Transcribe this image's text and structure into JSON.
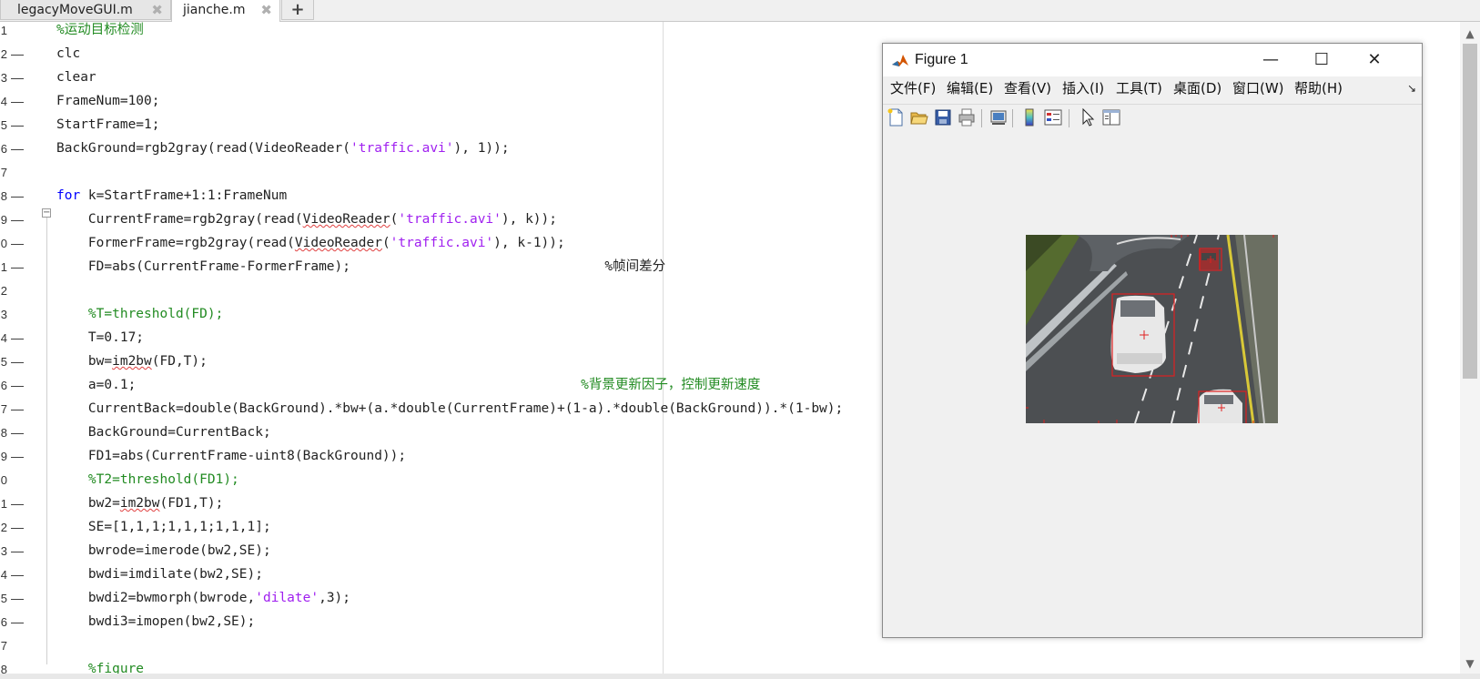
{
  "tabs": [
    {
      "label": "legacyMoveGUI.m",
      "active": false
    },
    {
      "label": "jianche.m",
      "active": true
    }
  ],
  "tab_add_label": "+",
  "tab_close_glyph": "✖",
  "editor": {
    "line_numbers": [
      "1",
      "2",
      "3",
      "4",
      "5",
      "6",
      "7",
      "8",
      "9",
      "0",
      "1",
      "2",
      "3",
      "4",
      "5",
      "6",
      "7",
      "8",
      "9",
      "0",
      "1",
      "2",
      "3",
      "4",
      "5",
      "6",
      "7",
      "8"
    ],
    "lines": [
      [
        {
          "t": "%运动目标检测",
          "c": "cm"
        }
      ],
      [
        {
          "t": "clc",
          "c": ""
        }
      ],
      [
        {
          "t": "clear",
          "c": ""
        }
      ],
      [
        {
          "t": "FrameNum=100;",
          "c": ""
        }
      ],
      [
        {
          "t": "StartFrame=1;",
          "c": ""
        }
      ],
      [
        {
          "t": "BackGround=rgb2gray(read(VideoReader(",
          "c": ""
        },
        {
          "t": "'traffic.avi'",
          "c": "str"
        },
        {
          "t": "), 1));",
          "c": ""
        }
      ],
      [],
      [
        {
          "t": "for",
          "c": "kw"
        },
        {
          "t": " k=StartFrame+1:1:FrameNum",
          "c": ""
        }
      ],
      [
        {
          "t": "    CurrentFrame=rgb2gray(read(",
          "c": ""
        },
        {
          "t": "VideoReader",
          "c": "squig"
        },
        {
          "t": "(",
          "c": ""
        },
        {
          "t": "'traffic.avi'",
          "c": "str"
        },
        {
          "t": "), k));",
          "c": ""
        }
      ],
      [
        {
          "t": "    FormerFrame=rgb2gray(read(",
          "c": ""
        },
        {
          "t": "VideoReader",
          "c": "squig"
        },
        {
          "t": "(",
          "c": ""
        },
        {
          "t": "'traffic.avi'",
          "c": "str"
        },
        {
          "t": "), k-1));",
          "c": ""
        }
      ],
      [
        {
          "t": "    FD=abs(CurrentFrame-FormerFrame);                                %帧间差分",
          "c": ""
        }
      ],
      [],
      [
        {
          "t": "    %T=threshold(FD);",
          "c": "cm"
        }
      ],
      [
        {
          "t": "    T=0.17;",
          "c": ""
        }
      ],
      [
        {
          "t": "    bw=",
          "c": ""
        },
        {
          "t": "im2bw",
          "c": "squig"
        },
        {
          "t": "(FD,T);",
          "c": ""
        }
      ],
      [
        {
          "t": "    a",
          "c": ""
        },
        {
          "t": "=0.1;",
          "c": ""
        },
        {
          "t": "                                                        %背景更新因子，控制更新速度",
          "c": "cm"
        }
      ],
      [
        {
          "t": "    CurrentBack=double(BackGround).*bw+(a.*double(CurrentFrame)+(1-a).*double(BackGround)).*(1-bw);",
          "c": ""
        }
      ],
      [
        {
          "t": "    BackGround=CurrentBack;",
          "c": ""
        }
      ],
      [
        {
          "t": "    FD1=abs(CurrentFrame-uint8(BackGround));",
          "c": ""
        }
      ],
      [
        {
          "t": "    %T2=threshold(FD1);",
          "c": "cm"
        }
      ],
      [
        {
          "t": "    bw2=",
          "c": ""
        },
        {
          "t": "im2bw",
          "c": "squig"
        },
        {
          "t": "(FD1,T);",
          "c": ""
        }
      ],
      [
        {
          "t": "    SE=[1,1,1;1,1,1;1,1,1];",
          "c": ""
        }
      ],
      [
        {
          "t": "    bwrode=imerode(bw2,SE);",
          "c": ""
        }
      ],
      [
        {
          "t": "    bwdi=imdilate(bw2,SE);",
          "c": ""
        }
      ],
      [
        {
          "t": "    bwdi2=bwmorph(bwrode,",
          "c": ""
        },
        {
          "t": "'dilate'",
          "c": "str"
        },
        {
          "t": ",3);",
          "c": ""
        }
      ],
      [
        {
          "t": "    bwdi3=imopen(bw2,SE);",
          "c": ""
        }
      ],
      [],
      [
        {
          "t": "    %figure",
          "c": "cm"
        }
      ]
    ],
    "executable_lines": [
      false,
      true,
      true,
      true,
      true,
      true,
      false,
      true,
      true,
      true,
      true,
      false,
      false,
      true,
      true,
      true,
      true,
      true,
      true,
      false,
      true,
      true,
      true,
      true,
      true,
      true,
      false,
      false
    ],
    "fold_glyph": "−",
    "dash_glyph": "—"
  },
  "figure": {
    "title": "Figure 1",
    "window_buttons": {
      "minimize": "—",
      "maximize": "☐",
      "close": "✕"
    },
    "menu": [
      "文件(F)",
      "编辑(E)",
      "查看(V)",
      "插入(I)",
      "工具(T)",
      "桌面(D)",
      "窗口(W)",
      "帮助(H)"
    ],
    "menu_overflow": "↘",
    "toolbar_icons": [
      "new-figure-icon",
      "open-icon",
      "save-icon",
      "print-icon",
      "link-plot-icon",
      "colorbar-icon",
      "legend-icon",
      "select-pointer-icon",
      "property-editor-icon"
    ],
    "detections": 3
  },
  "colors": {
    "comment": "#228b22",
    "keyword": "#0000ff",
    "string": "#a020f0",
    "detection_box": "#e02020"
  }
}
